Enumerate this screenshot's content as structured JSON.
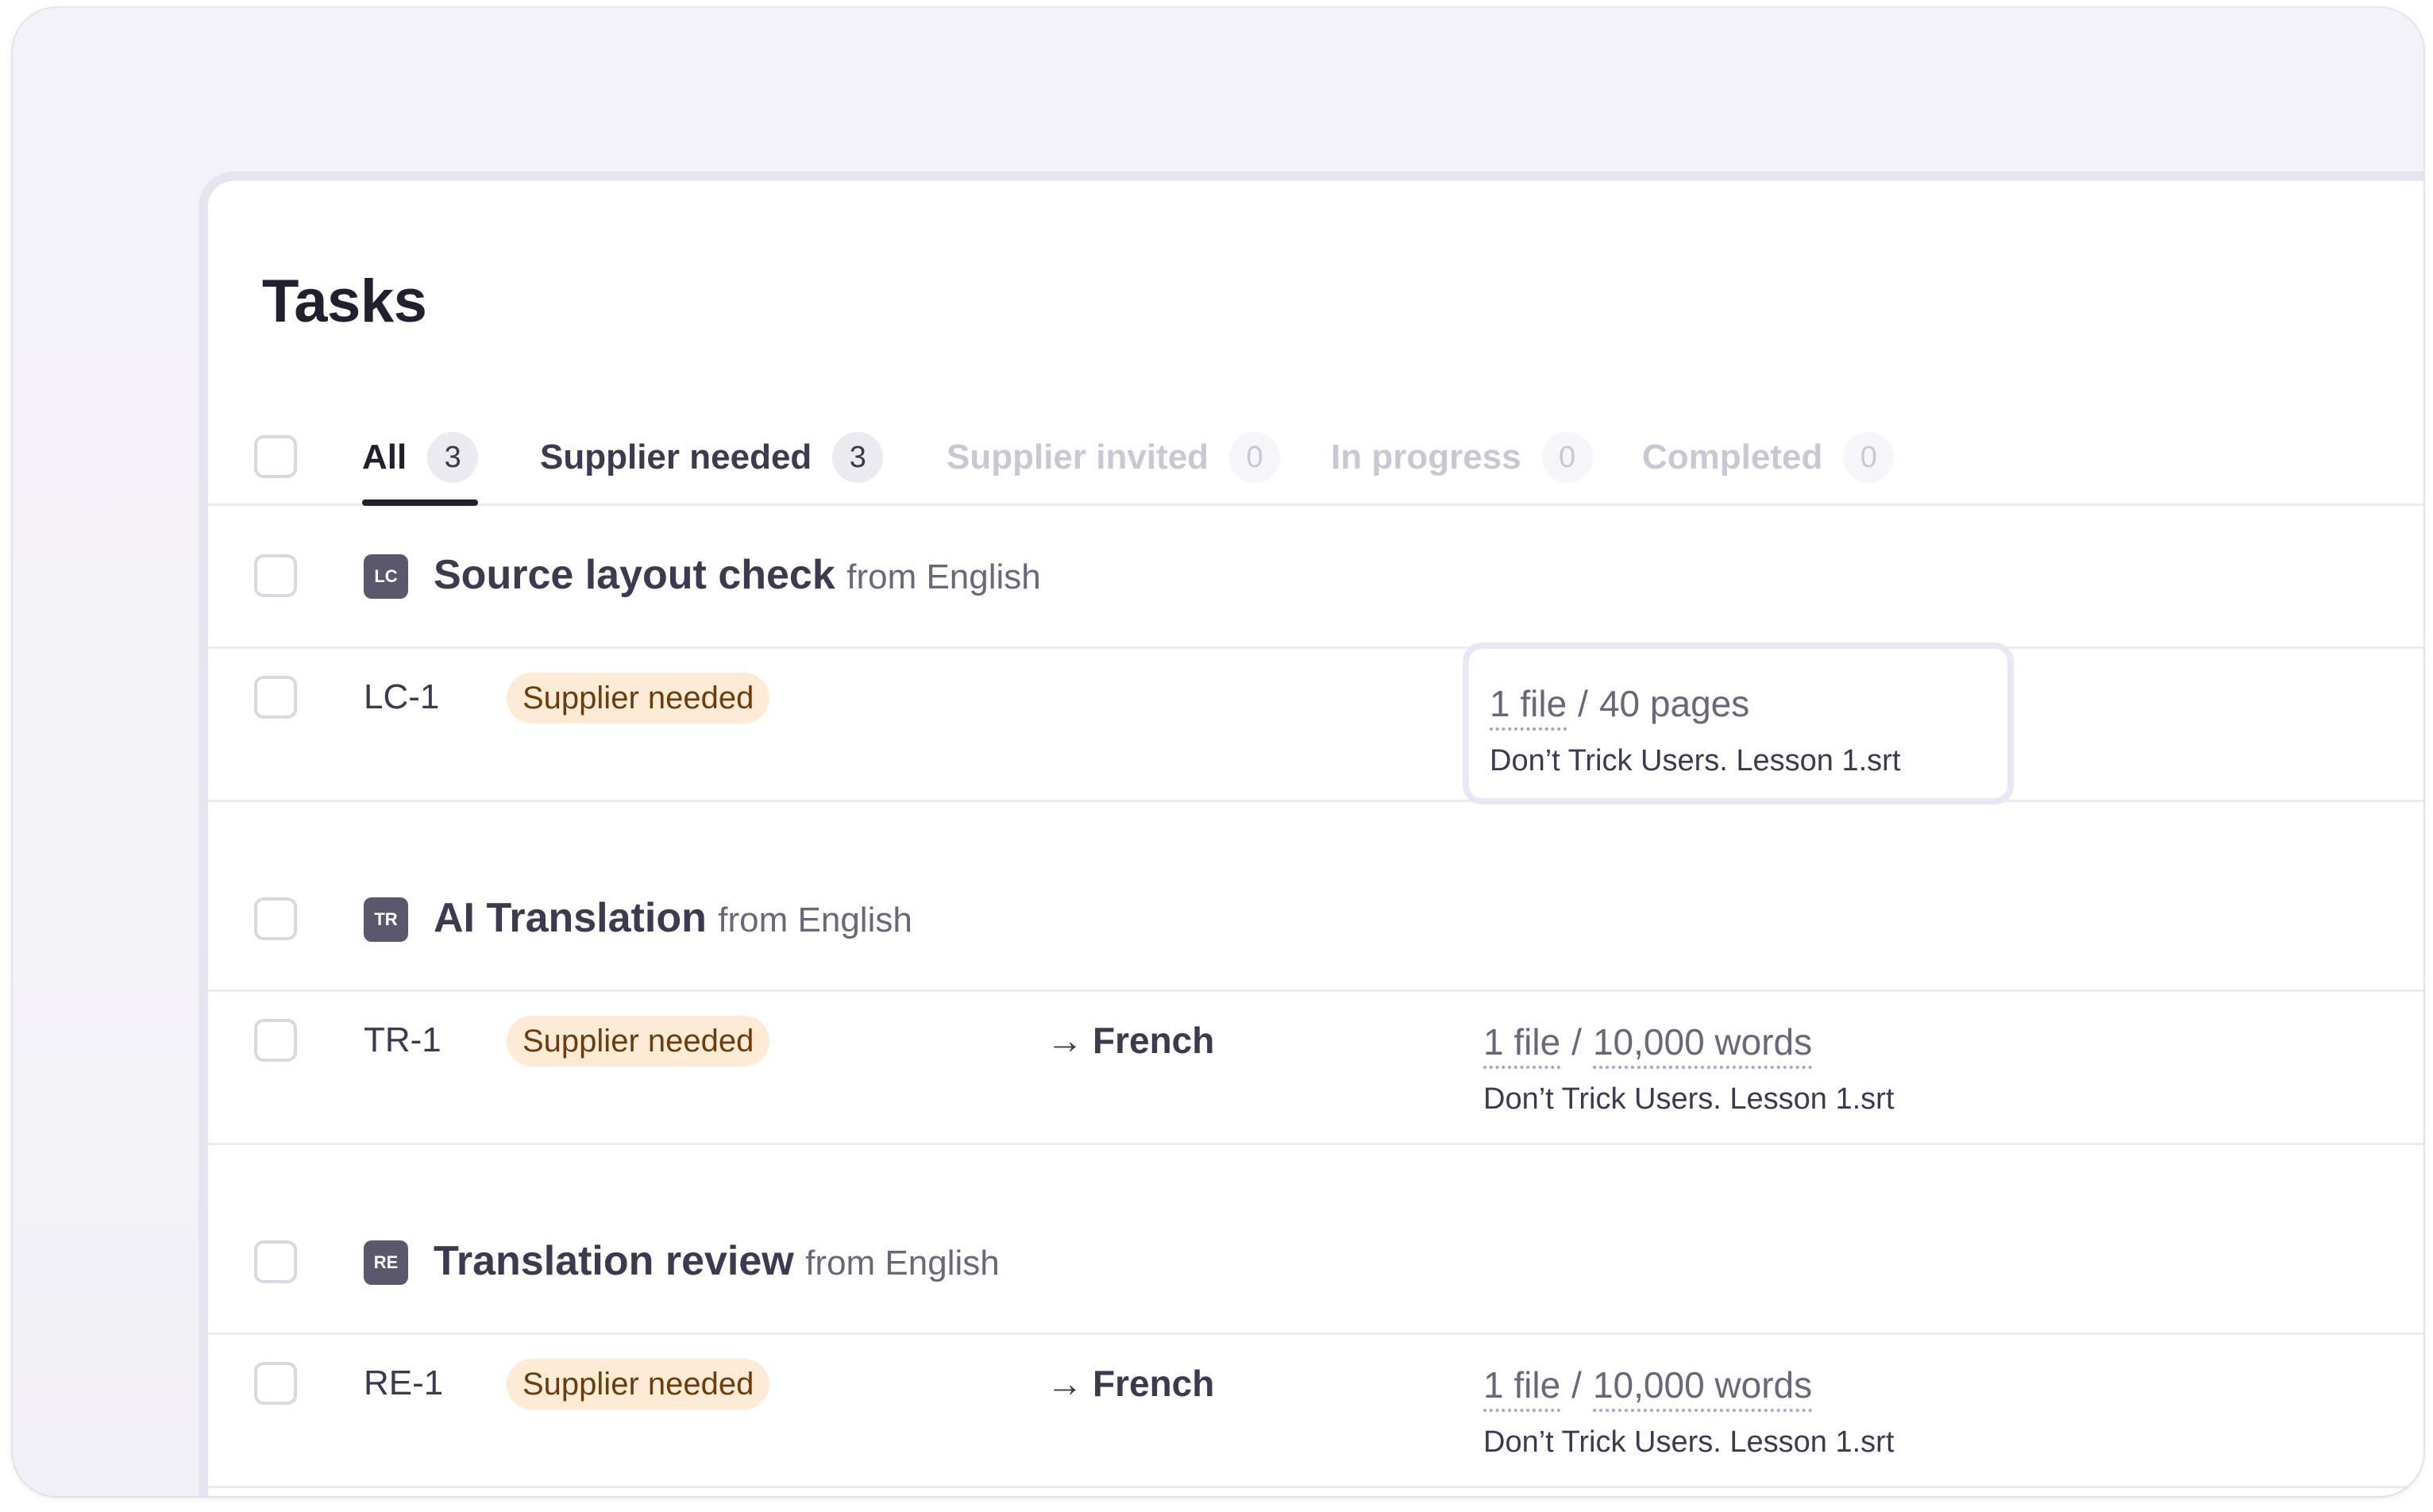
{
  "page": {
    "title": "Tasks"
  },
  "tabs": [
    {
      "label": "All",
      "count": "3"
    },
    {
      "label": "Supplier needed",
      "count": "3"
    },
    {
      "label": "Supplier invited",
      "count": "0"
    },
    {
      "label": "In progress",
      "count": "0"
    },
    {
      "label": "Completed",
      "count": "0"
    }
  ],
  "groups": [
    {
      "badge": "LC",
      "name": "Source layout check",
      "from": "from English",
      "task": {
        "id": "LC-1",
        "status": "Supplier needed",
        "target": "",
        "files": "1 file",
        "separator": "/",
        "amount": "40 pages",
        "filename": "Don’t Trick Users. Lesson 1.srt"
      }
    },
    {
      "badge": "TR",
      "name": "AI Translation",
      "from": "from English",
      "task": {
        "id": "TR-1",
        "status": "Supplier needed",
        "arrow": "→",
        "target": "French",
        "files": "1 file",
        "separator": "/",
        "amount": "10,000 words",
        "filename": "Don’t Trick Users. Lesson 1.srt"
      }
    },
    {
      "badge": "RE",
      "name": "Translation review",
      "from": "from English",
      "task": {
        "id": "RE-1",
        "status": "Supplier needed",
        "arrow": "→",
        "target": "French",
        "files": "1 file",
        "separator": "/",
        "amount": "10,000 words",
        "filename": "Don’t Trick Users. Lesson 1.srt"
      }
    }
  ],
  "colors": {
    "accent": "#22202e",
    "status_bg": "#fdebd6",
    "status_text": "#6b3c0d",
    "type_badge": "#5b586d"
  }
}
